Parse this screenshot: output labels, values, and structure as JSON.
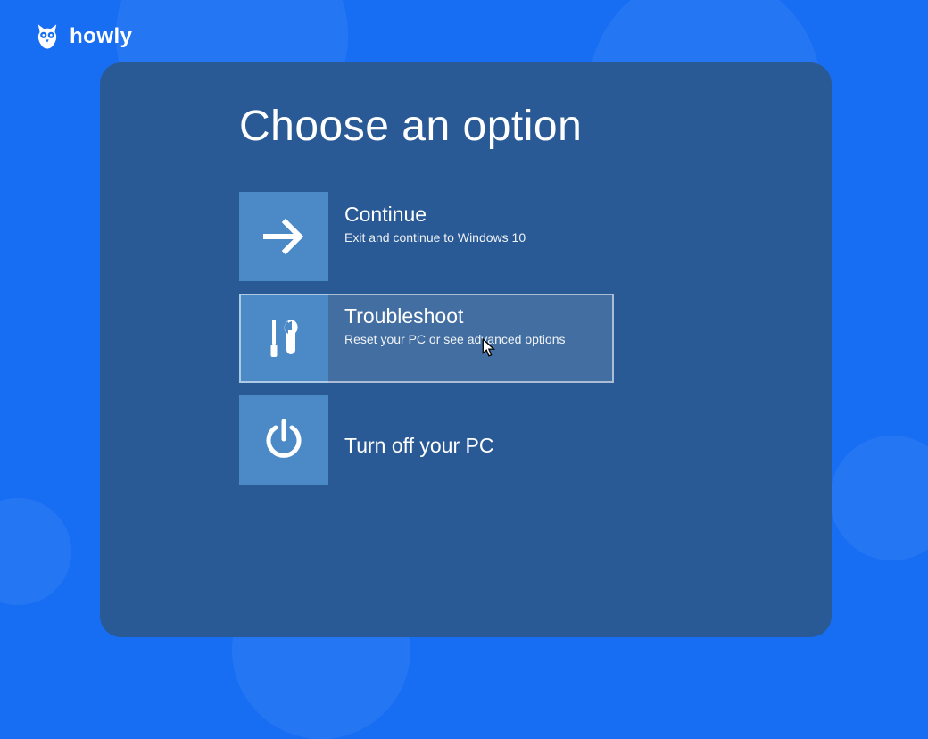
{
  "brand": {
    "name": "howly"
  },
  "screen": {
    "title": "Choose an option"
  },
  "options": [
    {
      "id": "continue",
      "title": "Continue",
      "description": "Exit and continue to Windows 10",
      "icon": "arrow-right",
      "hovered": false
    },
    {
      "id": "troubleshoot",
      "title": "Troubleshoot",
      "description": "Reset your PC or see advanced options",
      "icon": "tools",
      "hovered": true
    },
    {
      "id": "turn-off",
      "title": "Turn off your PC",
      "description": "",
      "icon": "power",
      "hovered": false
    }
  ]
}
